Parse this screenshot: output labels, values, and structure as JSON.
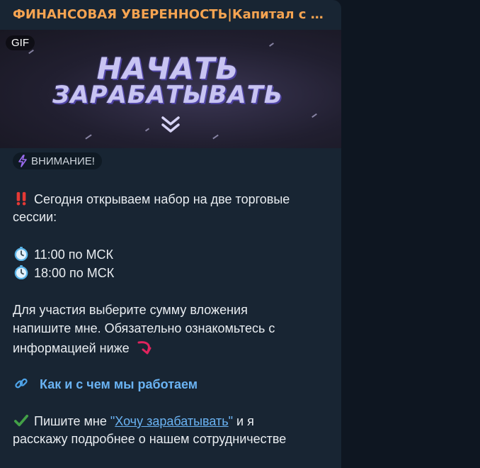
{
  "message": {
    "channel_title": "ФИНАНСОВАЯ УВЕРЕННОСТЬ|Капитал с Еле...",
    "media": {
      "badge": "GIF",
      "banner_line1": "НАЧАТЬ",
      "banner_line2": "ЗАРАБАТЫВАТЬ",
      "chevron_icon": "double-chevron-down-icon"
    },
    "attention_label": "ВНИМАНИЕ!",
    "line_intro_1": "Сегодня открываем набор на две торговые",
    "line_intro_2": "сессии:",
    "session_1": "11:00 по МСК",
    "session_2": "18:00 по МСК",
    "line_info_1": "Для участия выберите сумму вложения",
    "line_info_2": "напишите мне. Обязательно ознакомьтесь с",
    "line_info_3": "информацией ниже",
    "link_label": "Как и с чем мы работаем",
    "line_cta_prefix": "Пишите мне ",
    "line_cta_quote_open": "\"",
    "line_cta_link": "Хочу зарабатывать",
    "line_cta_quote_close": "\"",
    "line_cta_suffix": " и я",
    "line_cta_2": "расскажу подробнее о нашем сотрудничестве"
  },
  "colors": {
    "background": "#0e1621",
    "bubble": "#182533",
    "channel_title": "#f5a451",
    "link": "#6ab3f3",
    "text": "#e9edf1"
  },
  "icons": [
    "lightning-icon",
    "double-exclamation-icon",
    "stopwatch-icon",
    "curved-arrow-icon",
    "link-icon",
    "check-mark-icon"
  ]
}
